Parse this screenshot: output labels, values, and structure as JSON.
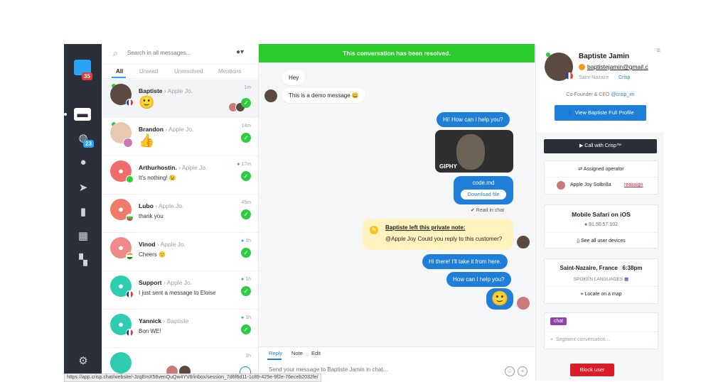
{
  "colors": {
    "resolved": "#2ccc2a",
    "accent": "#1f7ed8",
    "rail": "#2b2f3a",
    "block": "#d91e2a",
    "note": "#fff4bf"
  },
  "rail": {
    "logo_badge": "35",
    "globe_badge": "23",
    "icons": [
      "chat-icon",
      "globe-icon",
      "user-icon",
      "send-icon",
      "book-icon",
      "chart-icon",
      "plugins-icon",
      "settings-icon"
    ]
  },
  "search": {
    "placeholder": "Search in all messages..."
  },
  "filters": [
    "All",
    "Unread",
    "Unresolved",
    "Mentions"
  ],
  "conversations": [
    {
      "name": "Baptiste",
      "sub": "› Apple Jo.",
      "emoji": "🙂",
      "time": "1m",
      "avatar_color": "#5a4a40",
      "flag": "fr"
    },
    {
      "name": "Brandon",
      "sub": "› Apple Jo.",
      "emoji": "👍",
      "time": "14m",
      "avatar_color": "#e8c9b0",
      "flag": ""
    },
    {
      "name": "Arthurhostin.",
      "sub": "› Apple Jo.",
      "message": "It's nothing! 😉",
      "time": "17m",
      "avatar_color": "#f06b6b",
      "flag": "br"
    },
    {
      "name": "Lubo",
      "sub": "› Apple Jo.",
      "message": "thank you",
      "time": "45m",
      "avatar_color": "#f07b6b",
      "flag": "bg"
    },
    {
      "name": "Vinod",
      "sub": "› Apple Jo.",
      "message": "Cheers 🙂",
      "time": "1h",
      "avatar_color": "#f08a8a",
      "flag": "in"
    },
    {
      "name": "Support",
      "sub": "› Apple Jo.",
      "message": "I just sent a message to Eloise",
      "time": "1h",
      "avatar_color": "#2ecdb0",
      "flag": "fr"
    },
    {
      "name": "Yannick",
      "sub": "› Baptiste",
      "message": "Bon WE!",
      "time": "1h",
      "avatar_color": "#2ecdb0",
      "flag": "fr"
    },
    {
      "name": "",
      "sub": "",
      "message": "",
      "time": "1h",
      "avatar_color": "#2ecdb0",
      "flag": ""
    }
  ],
  "chat": {
    "banner": "This conversation has been resolved.",
    "msg_hey": "Hey",
    "msg_demo": "This is a demo message 😀",
    "msg_help": "Hi! How can I help you?",
    "gif_label": "GIPHY",
    "file_name": "code.md",
    "file_button": "Download file",
    "read": "✔ Read in chat",
    "note_title": "Baptiste left this private note:",
    "note_text": "@Apple Joy Could you reply to this customer?",
    "msg_take": "Hi there! I'll take it from here.",
    "msg_help2": "How can I help you?",
    "emoji_out": "🙂",
    "tabs": [
      "Reply",
      "Note",
      "Edit"
    ],
    "composer_placeholder": "Send your message to Baptiste Jamin in chat..."
  },
  "profile": {
    "name": "Baptiste Jamin",
    "email": "baptistejamin@gmail.c",
    "location": "Saint-Nazaire",
    "site": "Crisp",
    "role": "Co-Founder & CEO",
    "role_handle": "@crisp_im",
    "view_profile": "View Baptiste Full Profile",
    "call": "Call with Crisp™",
    "assigned_label": "Assigned operator",
    "operator": "Apple Joy Solbrilla",
    "reassign": "reassign",
    "device": "Mobile Safari on iOS",
    "ip": "81.50.57.102",
    "see_devices": "See all user devices",
    "city": "Saint-Nazaire, France",
    "time": "6:38pm",
    "languages": "SPOKEN LANGUAGES",
    "locate": "Locate on a map",
    "tag": "chat",
    "segment_placeholder": "Segment conversation...",
    "block": "Block user"
  },
  "status_url": "https://app.crisp.chat/website/-JzqEmX56venQuQw4YV8/inbox/session_7d6f6d11-1c89-425e-9f2e-76eceb2032fe/"
}
